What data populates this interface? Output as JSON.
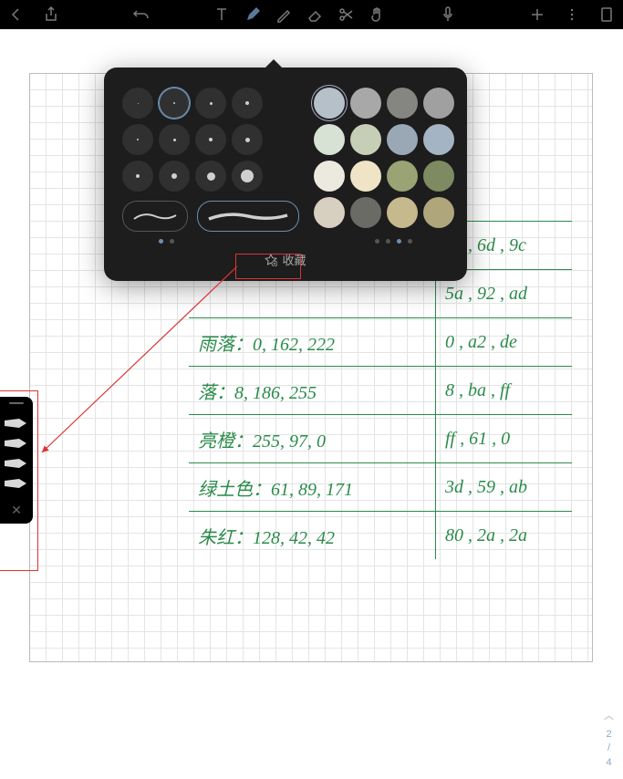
{
  "toolbar": {},
  "popover": {
    "size_rows": [
      [
        1,
        2,
        3,
        4
      ],
      [
        2,
        3,
        4,
        5
      ],
      [
        4,
        6,
        9,
        14
      ]
    ],
    "selected_size_idx": 1,
    "colors": [
      "#b5c0c9",
      "#a8a8a8",
      "#858582",
      "#a0a0a0",
      "#d8e2d4",
      "#c7ceb6",
      "#9aa8b6",
      "#a4b4c4",
      "#ece9df",
      "#efe4c5",
      "#9aa373",
      "#7e8b62",
      "#d7cfc0",
      "#6b6b66",
      "#c6b98e",
      "#b0a67c"
    ],
    "selected_color_idx": 0,
    "strokes": [
      70,
      110
    ],
    "selected_stroke_idx": 1,
    "left_page_dots": 2,
    "left_active": 0,
    "right_page_dots": 4,
    "right_active": 2,
    "fav_label": "收藏"
  },
  "handwriting": [
    {
      "left": "",
      "right": "10 , 6d , 9c"
    },
    {
      "left": "",
      "right": "5a , 92 , ad"
    },
    {
      "left": "雨落：0, 162, 222",
      "right": "0 , a2 , de"
    },
    {
      "left": "落：8, 186, 255",
      "right": "8 , ba , ff"
    },
    {
      "left": "亮橙：255, 97, 0",
      "right": "ff , 61 , 0"
    },
    {
      "left": "绿土色：61, 89, 171",
      "right": "3d , 59 , ab"
    },
    {
      "left": "朱红：128, 42, 42",
      "right": "80 , 2a , 2a"
    }
  ],
  "side_nibs": [
    "#d8d8d8",
    "#d8d8d8",
    "#d8d8d8",
    "#d8d8d8"
  ],
  "page": {
    "current": "2",
    "sep": "/",
    "total": "4"
  }
}
